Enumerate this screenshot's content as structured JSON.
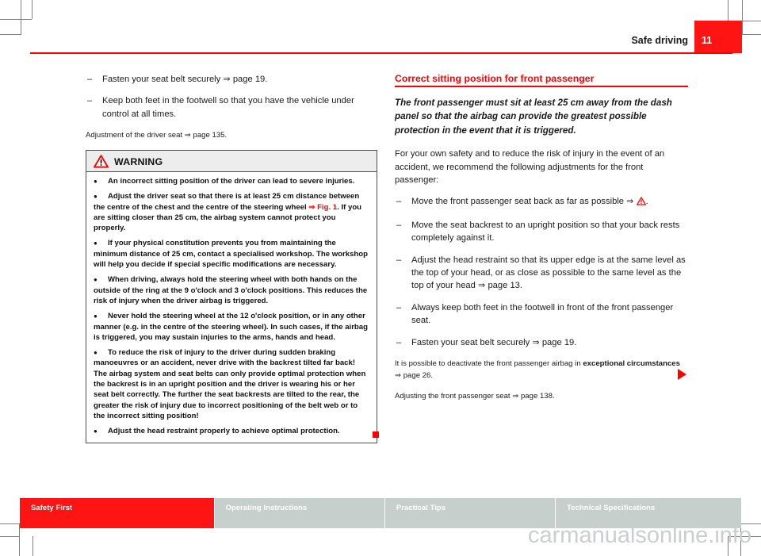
{
  "header": {
    "chapter_title": "Safe driving",
    "page_number": "11",
    "accent_color": "#ff0000",
    "page_box_color": "#ff1414"
  },
  "left_column": {
    "dash_items": [
      "Fasten your seat belt securely ⇒ page 19.",
      "Keep both feet in the footwell so that you have the vehicle under control at all times."
    ],
    "note": "Adjustment of the driver seat ⇒ page 135.",
    "warning": {
      "icon": "warning-triangle-icon",
      "title": "WARNING",
      "bullets": [
        "An incorrect sitting position of the driver can lead to severe injuries.",
        "Adjust the driver seat so that there is at least 25 cm distance between the centre of the chest and the centre of the steering wheel ⇒ Fig. 1. If you are sitting closer than 25 cm, the airbag system cannot protect you properly.",
        "If your physical constitution prevents you from maintaining the minimum distance of 25 cm, contact a specialised workshop. The workshop will help you decide if special specific modifications are necessary.",
        "When driving, always hold the steering wheel with both hands on the outside of the ring at the 9 o'clock and 3 o'clock positions. This reduces the risk of injury when the driver airbag is triggered.",
        "Never hold the steering wheel at the 12 o'clock position, or in any other manner (e.g. in the centre of the steering wheel). In such cases, if the airbag is triggered, you may sustain injuries to the arms, hands and head.",
        "To reduce the risk of injury to the driver during sudden braking manoeuvres or an accident, never drive with the backrest tilted far back! The airbag system and seat belts can only provide optimal protection when the backrest is in an upright position and the driver is wearing his or her seat belt correctly. The further the seat backrests are tilted to the rear, the greater the risk of injury due to incorrect positioning of the belt web or to the incorrect sitting position!",
        "Adjust the head restraint properly to achieve optimal protection."
      ],
      "figure_reference": "⇒ Fig. 1"
    },
    "end_marker": "red-square-end-marker"
  },
  "right_column": {
    "heading": "Correct sitting position for front passenger",
    "lead_paragraph": "The front passenger must sit at least 25 cm away from the dash panel so that the airbag can provide the greatest possible protection in the event that it is triggered.",
    "intro": "For your own safety and to reduce the risk of injury in the event of an accident, we recommend the following adjustments for the front passenger:",
    "dash_items": [
      "Move the front passenger seat back as far as possible ⇒ ⚠.",
      "Move the seat backrest to an upright position so that your back rests completely against it.",
      "Adjust the head restraint so that its upper edge is at the same level as the top of your head, or as close as possible to the same level as the top of your head ⇒ page 13.",
      "Always keep both feet in the footwell in front of the front passenger seat.",
      "Fasten your seat belt securely ⇒ page 19."
    ],
    "deactivate_note_prefix": "It is possible to deactivate the front passenger airbag in ",
    "deactivate_note_bold": "exceptional circumstances",
    "deactivate_note_suffix": " ⇒ page 26.",
    "adjusting_note": "Adjusting the front passenger seat ⇒ page 138.",
    "continue_marker": "red-triangle-continue-marker"
  },
  "footer": {
    "tabs": [
      {
        "label": "Safety First",
        "active": true
      },
      {
        "label": "Operating Instructions",
        "active": false
      },
      {
        "label": "Practical Tips",
        "active": false
      },
      {
        "label": "Technical Specifications",
        "active": false
      }
    ],
    "active_color": "#ff1414",
    "inactive_color": "#c6cfcc"
  },
  "watermark": "carmanualsonline.info"
}
